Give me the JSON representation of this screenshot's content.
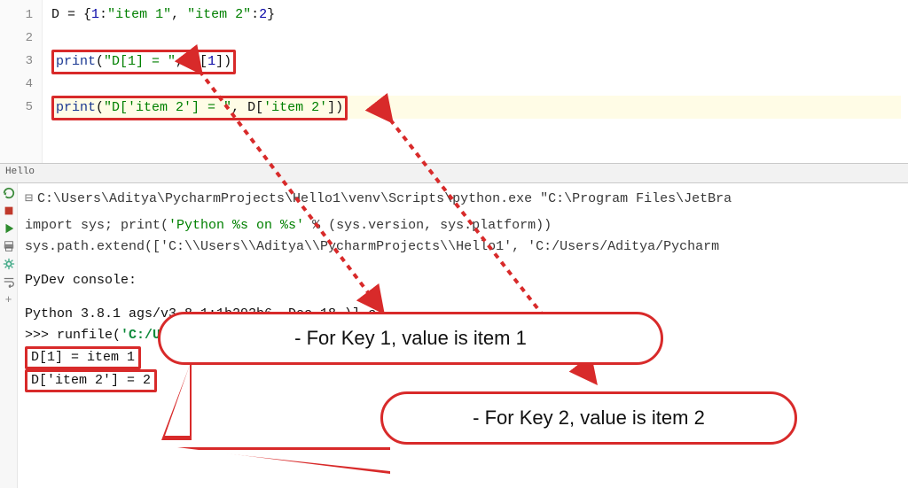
{
  "editor": {
    "lines": [
      {
        "num": "1",
        "parts": [
          {
            "c": "id",
            "t": "D "
          },
          {
            "c": "op",
            "t": "= {"
          },
          {
            "c": "num",
            "t": "1"
          },
          {
            "c": "op",
            "t": ":"
          },
          {
            "c": "str",
            "t": "\"item 1\""
          },
          {
            "c": "op",
            "t": ", "
          },
          {
            "c": "str",
            "t": "\"item 2\""
          },
          {
            "c": "op",
            "t": ":"
          },
          {
            "c": "num",
            "t": "2"
          },
          {
            "c": "op",
            "t": "}"
          }
        ],
        "boxed": false
      },
      {
        "num": "2",
        "parts": [],
        "boxed": false
      },
      {
        "num": "3",
        "parts": [
          {
            "c": "fn",
            "t": "print"
          },
          {
            "c": "op",
            "t": "("
          },
          {
            "c": "str",
            "t": "\"D[1] = \""
          },
          {
            "c": "op",
            "t": ", D["
          },
          {
            "c": "num",
            "t": "1"
          },
          {
            "c": "op",
            "t": "])"
          }
        ],
        "boxed": true
      },
      {
        "num": "4",
        "parts": [],
        "boxed": false
      },
      {
        "num": "5",
        "parts": [
          {
            "c": "fn",
            "t": "print"
          },
          {
            "c": "op",
            "t": "("
          },
          {
            "c": "str",
            "t": "\"D['item 2'] = \""
          },
          {
            "c": "op",
            "t": ", D["
          },
          {
            "c": "str",
            "t": "'item 2'"
          },
          {
            "c": "op",
            "t": "])"
          }
        ],
        "boxed": true,
        "hl": true
      }
    ]
  },
  "tab_label": "Hello",
  "console": {
    "banner": "C:\\Users\\Aditya\\PycharmProjects\\Hello1\\venv\\Scripts\\python.exe \"C:\\Program Files\\JetBra",
    "line2a": "import sys; print(",
    "line2b": "'Python %s on %s'",
    "line2c": " % (sys.version, sys.platform))",
    "line3": "sys.path.extend(['C:\\\\Users\\\\Aditya\\\\PycharmProjects\\\\Hello1', 'C:/Users/Aditya/Pycharm",
    "line4": "PyDev console:",
    "line5": "Python 3.8.1    ags/v3.8.1:1b293b6, Dec 18                                               )] c",
    "line6a": ">>> ",
    "line6b": "runfile(",
    "line6c": "'C:/Users/Aditya/PycharmProj                                                      /Py",
    "out1": "D[1] =  item 1",
    "out2": "D['item 2'] =  2"
  },
  "annotations": {
    "bubble1": "- For Key 1, value is item 1",
    "bubble2": "- For Key 2, value is item 2"
  },
  "icons": {
    "rerun": "rerun-icon",
    "stop": "stop-icon",
    "play": "play-icon",
    "settings": "settings-icon",
    "wrap": "wrap-icon",
    "print": "print-icon",
    "add": "add-icon"
  }
}
